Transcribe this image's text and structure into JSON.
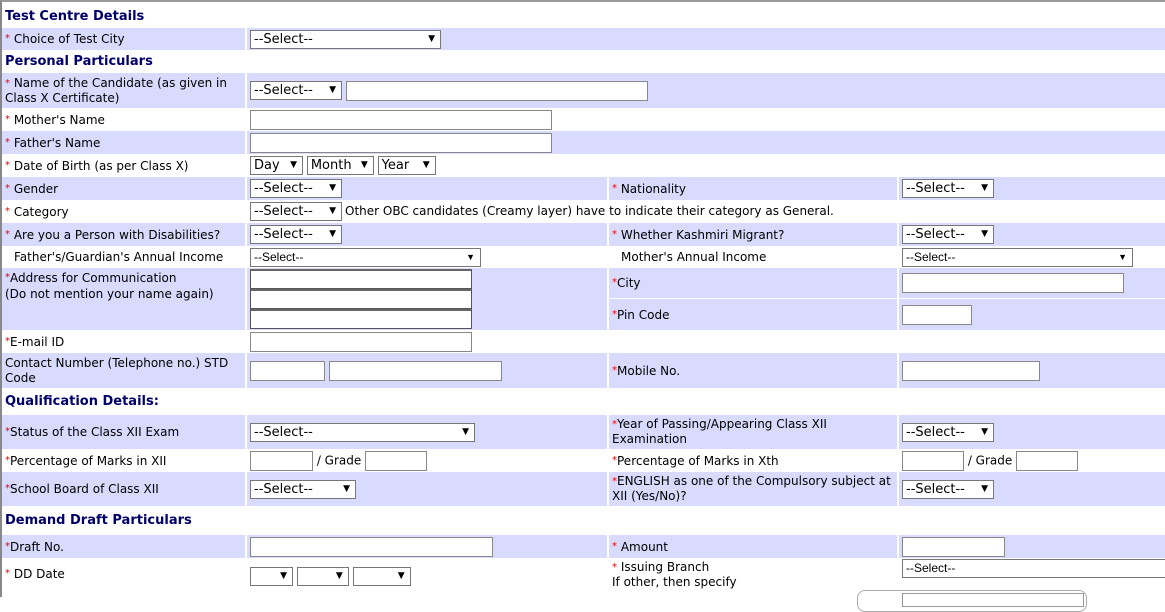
{
  "sections": {
    "test_centre": "Test Centre Details",
    "personal": "Personal Particulars",
    "qualification": "Qualification Details:",
    "demand_draft": "Demand Draft Particulars"
  },
  "required_marker": "*",
  "fields": {
    "test_city": {
      "label": "Choice of Test City",
      "value": "--Select--"
    },
    "candidate_name": {
      "label": "Name of the Candidate (as given in Class X Certificate)",
      "title_value": "--Select--",
      "value": ""
    },
    "mother_name": {
      "label": "Mother's Name",
      "value": ""
    },
    "father_name": {
      "label": "Father's Name",
      "value": ""
    },
    "dob": {
      "label": "Date of Birth (as per Class X)",
      "day": "Day",
      "month": "Month",
      "year": "Year"
    },
    "gender": {
      "label": "Gender",
      "value": "--Select--"
    },
    "nationality": {
      "label": "Nationality",
      "value": "--Select--"
    },
    "category": {
      "label": "Category",
      "value": "--Select--",
      "note": "Other OBC candidates (Creamy layer) have to indicate their category as General."
    },
    "disability": {
      "label": "Are you a Person with Disabilities?",
      "value": "--Select--"
    },
    "kashmiri_migrant": {
      "label": "Whether Kashmiri Migrant?",
      "value": "--Select--"
    },
    "father_income": {
      "label": "Father's/Guardian's Annual Income",
      "value": "--Select--"
    },
    "mother_income": {
      "label": "Mother's Annual Income",
      "value": "--Select--"
    },
    "address": {
      "label": "Address for Communication",
      "sublabel": "(Do not mention your name again)",
      "lines": [
        "",
        "",
        ""
      ]
    },
    "city": {
      "label": "City",
      "value": ""
    },
    "pin": {
      "label": "Pin Code",
      "value": ""
    },
    "email": {
      "label": "E-mail ID",
      "value": ""
    },
    "contact": {
      "label": "Contact Number (Telephone no.) STD Code",
      "std": "",
      "number": ""
    },
    "mobile": {
      "label": "Mobile No.",
      "value": ""
    },
    "xii_status": {
      "label": "Status of the Class XII Exam",
      "value": "--Select--"
    },
    "xii_year": {
      "label": "Year of Passing/Appearing Class XII Examination",
      "value": "--Select--"
    },
    "xii_percent": {
      "label": "Percentage of Marks in XII",
      "grade_label": "/ Grade",
      "value": "",
      "grade": ""
    },
    "x_percent": {
      "label": "Percentage of Marks in Xth",
      "grade_label": "/ Grade",
      "value": "",
      "grade": ""
    },
    "xii_board": {
      "label": "School Board of Class XII",
      "value": "--Select--"
    },
    "english": {
      "label": "ENGLISH as one of the Compulsory subject at XII (Yes/No)?",
      "value": "--Select--"
    },
    "draft_no": {
      "label": "Draft No.",
      "value": ""
    },
    "amount": {
      "label": "Amount",
      "value": ""
    },
    "dd_date": {
      "label": "DD Date",
      "day": "",
      "month": "",
      "year": ""
    },
    "issuing_branch": {
      "label": "Issuing Branch",
      "sublabel": "If other, then specify",
      "value": "--Select--"
    }
  }
}
